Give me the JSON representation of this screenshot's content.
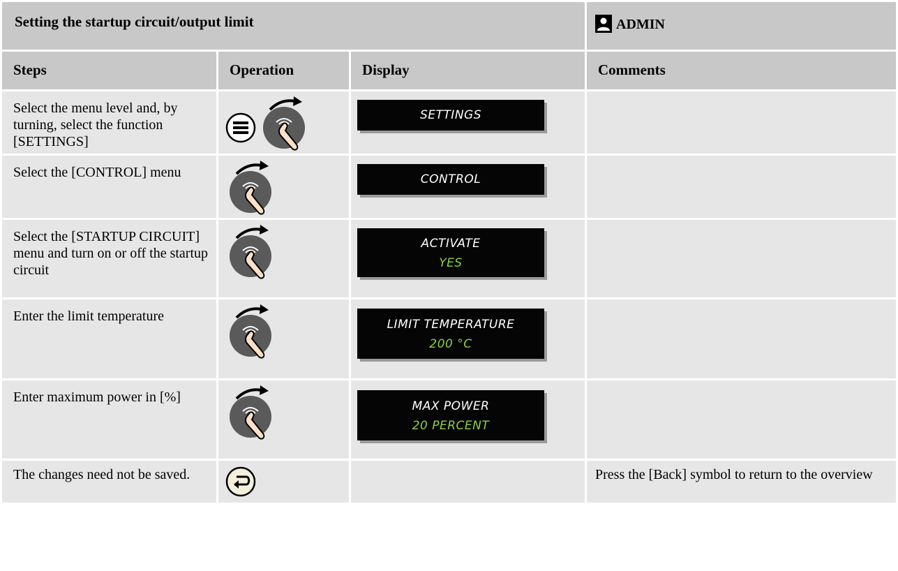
{
  "title": "Setting the startup circuit/output limit",
  "role_label": "ADMIN",
  "headers": {
    "steps": "Steps",
    "operation": "Operation",
    "display": "Display",
    "comments": "Comments"
  },
  "rows": [
    {
      "step": "Select the menu level and, by turning, select the function [SETTINGS]",
      "operation_icons": [
        "menu-button-icon",
        "turn-knob-icon"
      ],
      "display_line1": "SETTINGS",
      "display_line2": "",
      "comment": ""
    },
    {
      "step": "Select the [CONTROL] menu",
      "operation_icons": [
        "turn-knob-icon"
      ],
      "display_line1": "CONTROL",
      "display_line2": "",
      "comment": ""
    },
    {
      "step": "Select the [STARTUP CIRCUIT] menu and turn on or off the startup circuit",
      "operation_icons": [
        "turn-knob-icon"
      ],
      "display_line1": "ACTIVATE",
      "display_line2": "YES",
      "comment": ""
    },
    {
      "step": "Enter the limit temperature",
      "operation_icons": [
        "turn-knob-icon"
      ],
      "display_line1": "LIMIT TEMPERATURE",
      "display_line2": "200 °C",
      "comment": ""
    },
    {
      "step": "Enter maximum power in [%]",
      "operation_icons": [
        "turn-knob-icon"
      ],
      "display_line1": "MAX POWER",
      "display_line2": "20 PERCENT",
      "comment": ""
    },
    {
      "step": "The changes need not be saved.",
      "operation_icons": [
        "back-button-icon"
      ],
      "display_line1": "",
      "display_line2": "",
      "comment": "Press the [Back] symbol to return to the overview"
    }
  ],
  "colors": {
    "header_bg": "#c8c8c8",
    "cell_bg": "#e6e6e6",
    "lcd_bg": "#050505",
    "lcd_value": "#8ed13a"
  }
}
